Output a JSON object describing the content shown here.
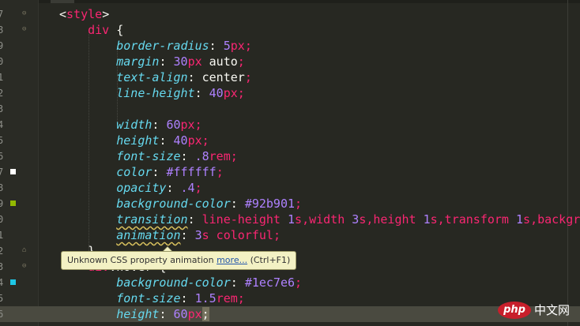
{
  "editor": {
    "lines": [
      {
        "num": "7",
        "fold": "open",
        "swatch": null,
        "segs": [
          [
            "pl",
            "<"
          ],
          [
            "t",
            "style"
          ],
          [
            "pl",
            ">"
          ]
        ]
      },
      {
        "num": "8",
        "fold": "open",
        "swatch": null,
        "segs": [
          [
            "pl",
            "    "
          ],
          [
            "t",
            "div"
          ],
          [
            "pl",
            " {"
          ]
        ]
      },
      {
        "num": "9",
        "fold": null,
        "swatch": null,
        "segs": [
          [
            "pl",
            "        "
          ],
          [
            "p",
            "border-radius"
          ],
          [
            "pl",
            ": "
          ],
          [
            "n",
            "5"
          ],
          [
            "u",
            "px"
          ],
          [
            "t",
            ";"
          ]
        ]
      },
      {
        "num": "0",
        "fold": null,
        "swatch": null,
        "segs": [
          [
            "pl",
            "        "
          ],
          [
            "p",
            "margin"
          ],
          [
            "pl",
            ": "
          ],
          [
            "n",
            "30"
          ],
          [
            "u",
            "px"
          ],
          [
            "pl",
            " auto"
          ],
          [
            "t",
            ";"
          ]
        ]
      },
      {
        "num": "1",
        "fold": null,
        "swatch": null,
        "segs": [
          [
            "pl",
            "        "
          ],
          [
            "p",
            "text-align"
          ],
          [
            "pl",
            ": center"
          ],
          [
            "t",
            ";"
          ]
        ]
      },
      {
        "num": "2",
        "fold": null,
        "swatch": null,
        "segs": [
          [
            "pl",
            "        "
          ],
          [
            "p",
            "line-height"
          ],
          [
            "pl",
            ": "
          ],
          [
            "n",
            "40"
          ],
          [
            "u",
            "px"
          ],
          [
            "t",
            ";"
          ]
        ]
      },
      {
        "num": "3",
        "fold": null,
        "swatch": null,
        "segs": []
      },
      {
        "num": "4",
        "fold": null,
        "swatch": null,
        "segs": [
          [
            "pl",
            "        "
          ],
          [
            "p",
            "width"
          ],
          [
            "pl",
            ": "
          ],
          [
            "n",
            "60"
          ],
          [
            "u",
            "px"
          ],
          [
            "t",
            ";"
          ]
        ]
      },
      {
        "num": "5",
        "fold": null,
        "swatch": null,
        "segs": [
          [
            "pl",
            "        "
          ],
          [
            "p",
            "height"
          ],
          [
            "pl",
            ": "
          ],
          [
            "n",
            "40"
          ],
          [
            "u",
            "px"
          ],
          [
            "t",
            ";"
          ]
        ]
      },
      {
        "num": "6",
        "fold": null,
        "swatch": null,
        "segs": [
          [
            "pl",
            "        "
          ],
          [
            "p",
            "font-size"
          ],
          [
            "pl",
            ": "
          ],
          [
            "n",
            ".8"
          ],
          [
            "u",
            "rem"
          ],
          [
            "t",
            ";"
          ]
        ]
      },
      {
        "num": "7",
        "fold": null,
        "swatch": "#ffffff",
        "segs": [
          [
            "pl",
            "        "
          ],
          [
            "p",
            "color"
          ],
          [
            "pl",
            ": "
          ],
          [
            "v",
            "#ffffff"
          ],
          [
            "t",
            ";"
          ]
        ]
      },
      {
        "num": "8",
        "fold": null,
        "swatch": null,
        "segs": [
          [
            "pl",
            "        "
          ],
          [
            "p",
            "opacity"
          ],
          [
            "pl",
            ": "
          ],
          [
            "n",
            ".4"
          ],
          [
            "t",
            ";"
          ]
        ]
      },
      {
        "num": "9",
        "fold": null,
        "swatch": "#92b901",
        "segs": [
          [
            "pl",
            "        "
          ],
          [
            "p",
            "background-color"
          ],
          [
            "pl",
            ": "
          ],
          [
            "v",
            "#92b901"
          ],
          [
            "t",
            ";"
          ]
        ]
      },
      {
        "num": "0",
        "fold": null,
        "swatch": null,
        "segs": [
          [
            "pl",
            "        "
          ],
          [
            "p sq",
            "transition"
          ],
          [
            "pl",
            ": "
          ],
          [
            "t",
            "line-height "
          ],
          [
            "n",
            "1"
          ],
          [
            "u",
            "s"
          ],
          [
            "t",
            ",width "
          ],
          [
            "n",
            "3"
          ],
          [
            "u",
            "s"
          ],
          [
            "t",
            ",height "
          ],
          [
            "n",
            "1"
          ],
          [
            "u",
            "s"
          ],
          [
            "t",
            ",transform "
          ],
          [
            "n",
            "1"
          ],
          [
            "u",
            "s"
          ],
          [
            "t",
            ",backgr"
          ]
        ]
      },
      {
        "num": "1",
        "fold": null,
        "swatch": null,
        "segs": [
          [
            "pl",
            "        "
          ],
          [
            "p sq",
            "animation"
          ],
          [
            "pl",
            ": "
          ],
          [
            "n",
            "3"
          ],
          [
            "u",
            "s"
          ],
          [
            "t",
            " colorful"
          ],
          [
            "t",
            ";"
          ]
        ]
      },
      {
        "num": "2",
        "fold": "close",
        "swatch": null,
        "segs": [
          [
            "pl",
            "    }"
          ]
        ]
      },
      {
        "num": "3",
        "fold": "open",
        "swatch": null,
        "segs": [
          [
            "pl",
            "    "
          ],
          [
            "t",
            "div"
          ],
          [
            "pl",
            ":hover {"
          ]
        ]
      },
      {
        "num": "4",
        "fold": null,
        "swatch": "#1ec7e6",
        "segs": [
          [
            "pl",
            "        "
          ],
          [
            "p",
            "background-color"
          ],
          [
            "pl",
            ": "
          ],
          [
            "v",
            "#1ec7e6"
          ],
          [
            "t",
            ";"
          ]
        ]
      },
      {
        "num": "5",
        "fold": null,
        "swatch": null,
        "segs": [
          [
            "pl",
            "        "
          ],
          [
            "p",
            "font-size"
          ],
          [
            "pl",
            ": "
          ],
          [
            "n",
            "1.5"
          ],
          [
            "u",
            "rem"
          ],
          [
            "t",
            ";"
          ]
        ]
      },
      {
        "num": "6",
        "fold": null,
        "swatch": null,
        "current": true,
        "segs": [
          [
            "pl",
            "        "
          ],
          [
            "p",
            "height"
          ],
          [
            "pl",
            ": "
          ],
          [
            "n",
            "60"
          ],
          [
            "u",
            "px"
          ],
          [
            "caret",
            ";"
          ]
        ]
      }
    ]
  },
  "tooltip": {
    "text": "Unknown CSS property animation ",
    "link": "more...",
    "shortcut": " (Ctrl+F1)"
  },
  "watermark": {
    "logo": "php",
    "site": "中文网"
  }
}
